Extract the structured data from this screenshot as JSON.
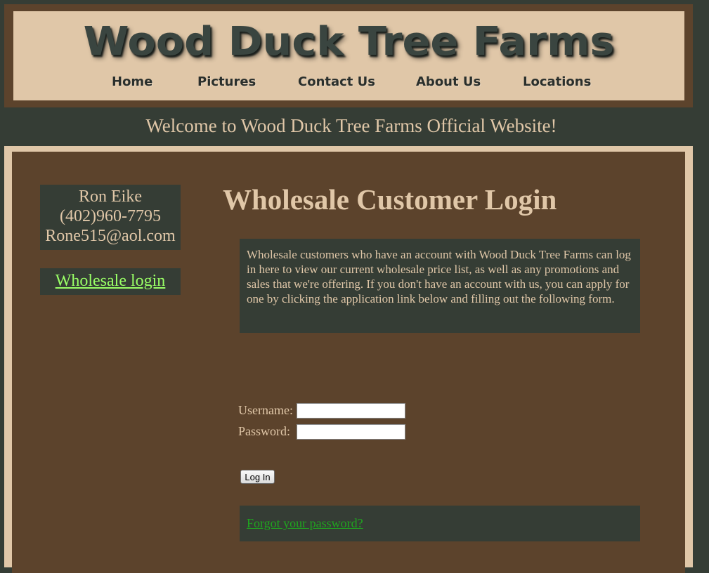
{
  "header": {
    "logo_text": "Wood Duck Tree Farms",
    "nav": [
      "Home",
      "Pictures",
      "Contact Us",
      "About Us",
      "Locations"
    ]
  },
  "welcome": "Welcome to Wood Duck Tree Farms Official Website!",
  "sidebar": {
    "contact_name": "Ron Eike",
    "contact_phone": "(402)960-7795",
    "contact_email": "Rone515@aol.com",
    "wholesale_link": "Wholesale login"
  },
  "main": {
    "title": "Wholesale Customer Login",
    "info": "Wholesale customers who have an account with Wood Duck Tree Farms can log in here to view our current wholesale price list, as well as any promotions and sales that we're offering. If you don't have an account with us, you can apply for one by clicking the application link below and filling out the following form.",
    "username_label": "Username:",
    "password_label": "Password:",
    "username_value": "",
    "password_value": "",
    "login_button": "Log In",
    "forgot_link": "Forgot your password?"
  },
  "colors": {
    "background": "#353d35",
    "brown": "#5c432c",
    "tan": "#e0c7a8",
    "link_green": "#99ff66",
    "forgot_green": "#1fa61f"
  }
}
